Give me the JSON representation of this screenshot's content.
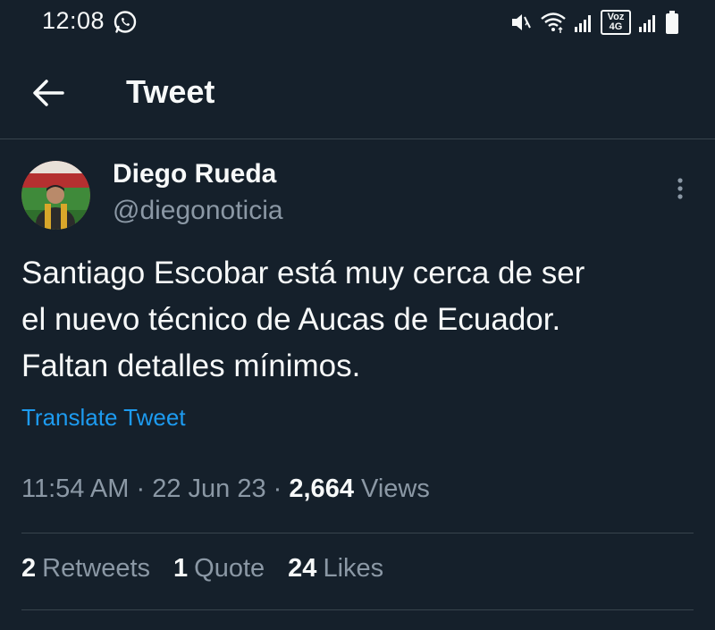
{
  "status_bar": {
    "time": "12:08",
    "volte_label": "Voz 4G",
    "icons": [
      "whatsapp-icon",
      "mute-icon",
      "wifi-icon",
      "signal-icon",
      "volte-icon",
      "signal-icon",
      "battery-icon"
    ]
  },
  "header": {
    "back_icon": "back-arrow-icon",
    "title": "Tweet"
  },
  "tweet": {
    "author": {
      "name": "Diego Rueda",
      "handle": "@diegonoticia"
    },
    "text_lines": [
      "Santiago Escobar está muy cerca de ser",
      "el nuevo técnico de Aucas de Ecuador.",
      "Faltan detalles mínimos."
    ],
    "translate_label": "Translate Tweet",
    "time": "11:54 AM",
    "date": "22 Jun 23",
    "separator": "·",
    "views_count": "2,664",
    "views_label": "Views",
    "stats": {
      "retweets_count": "2",
      "retweets_label": "Retweets",
      "quotes_count": "1",
      "quotes_label": "Quote",
      "likes_count": "24",
      "likes_label": "Likes"
    }
  },
  "colors": {
    "background": "#15202b",
    "text": "#f7f9f9",
    "secondary_text": "#8b98a5",
    "link": "#1d9bf0",
    "divider": "#38444d"
  }
}
